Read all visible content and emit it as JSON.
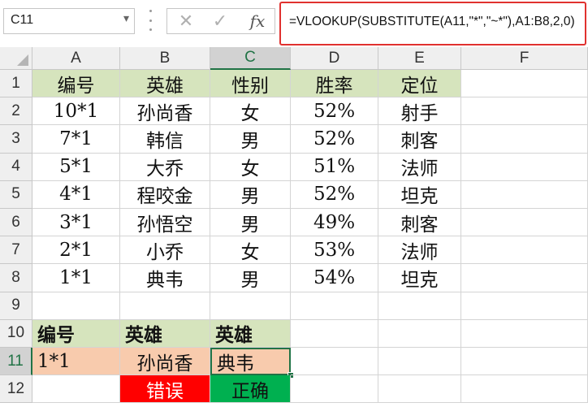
{
  "name_box": {
    "value": "C11"
  },
  "formula_bar": {
    "cancel_icon": "close-icon",
    "enter_icon": "check-icon",
    "fx_label": "fx",
    "formula": "=VLOOKUP(SUBSTITUTE(A11,\"*\",\"~*\"),A1:B8,2,0)"
  },
  "sheet": {
    "columns": [
      "A",
      "B",
      "C",
      "D",
      "E",
      "F"
    ],
    "selected_column": "C",
    "selected_row": "11",
    "rows": [
      {
        "num": "1",
        "cells": [
          "编号",
          "英雄",
          "性别",
          "胜率",
          "定位",
          ""
        ]
      },
      {
        "num": "2",
        "cells": [
          "10*1",
          "孙尚香",
          "女",
          "52%",
          "射手",
          ""
        ]
      },
      {
        "num": "3",
        "cells": [
          "7*1",
          "韩信",
          "男",
          "52%",
          "刺客",
          ""
        ]
      },
      {
        "num": "4",
        "cells": [
          "5*1",
          "大乔",
          "女",
          "51%",
          "法师",
          ""
        ]
      },
      {
        "num": "5",
        "cells": [
          "4*1",
          "程咬金",
          "男",
          "52%",
          "坦克",
          ""
        ]
      },
      {
        "num": "6",
        "cells": [
          "3*1",
          "孙悟空",
          "男",
          "49%",
          "刺客",
          ""
        ]
      },
      {
        "num": "7",
        "cells": [
          "2*1",
          "小乔",
          "女",
          "53%",
          "法师",
          ""
        ]
      },
      {
        "num": "8",
        "cells": [
          "1*1",
          "典韦",
          "男",
          "54%",
          "坦克",
          ""
        ]
      },
      {
        "num": "9",
        "cells": [
          "",
          "",
          "",
          "",
          "",
          ""
        ]
      },
      {
        "num": "10",
        "cells": [
          "编号",
          "英雄",
          "英雄",
          "",
          "",
          ""
        ]
      },
      {
        "num": "11",
        "cells": [
          "1*1",
          "孙尚香",
          "典韦",
          "",
          "",
          ""
        ]
      },
      {
        "num": "12",
        "cells": [
          "",
          "错误",
          "正确",
          "",
          "",
          ""
        ]
      }
    ]
  },
  "colors": {
    "header_fill": "#d6e4bd",
    "lookup_fill": "#f8cbad",
    "wrong_fill": "#ff0000",
    "right_fill": "#00b050",
    "formula_highlight": "#e0312f",
    "selection": "#217346"
  }
}
